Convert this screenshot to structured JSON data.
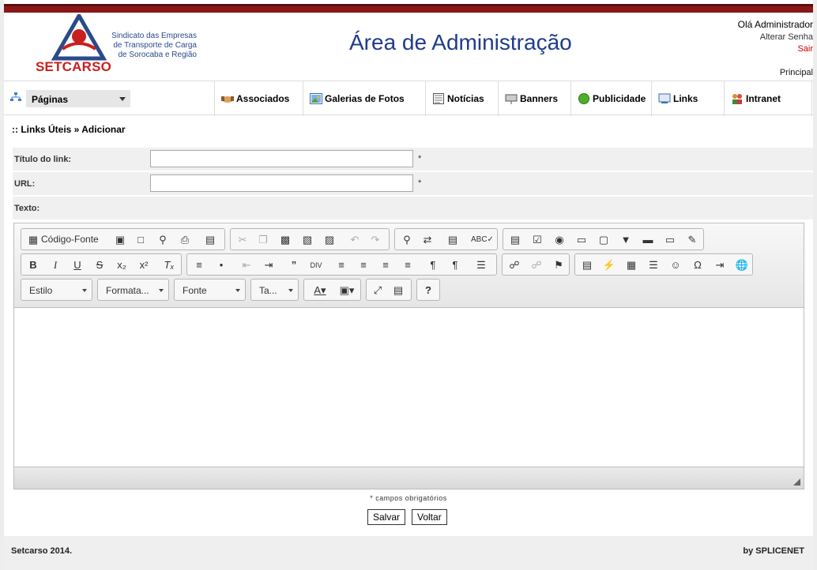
{
  "header": {
    "logo_text": "SETCARSO",
    "logo_caption": [
      "Sindicato das Empresas",
      "de Transporte de Carga",
      "de Sorocaba e Região"
    ],
    "title": "Área de Administração",
    "greeting": "Olá Administrador",
    "change_password": "Alterar Senha",
    "logout": "Sair",
    "home": "Principal"
  },
  "menu": {
    "pages_select": "Páginas",
    "items": [
      {
        "label": "Associados",
        "icon": "handshake-icon"
      },
      {
        "label": "Galerias de Fotos",
        "icon": "photo-gallery-icon"
      },
      {
        "label": "Notícias",
        "icon": "news-icon"
      },
      {
        "label": "Banners",
        "icon": "banner-icon"
      },
      {
        "label": "Publicidade",
        "icon": "green-circle-icon"
      },
      {
        "label": "Links",
        "icon": "links-icon"
      },
      {
        "label": "Intranet",
        "icon": "users-icon"
      }
    ]
  },
  "breadcrumb": ":: Links Úteis » Adicionar",
  "form": {
    "title_label": "Título do link:",
    "title_value": "",
    "url_label": "URL:",
    "url_value": "",
    "text_label": "Texto:",
    "required_mark": "*"
  },
  "editor": {
    "source_label": "Código-Fonte",
    "combos": [
      "Estilo",
      "Formata...",
      "Fonte",
      "Ta..."
    ],
    "help": "?"
  },
  "required_note": "* campos obrigatórios",
  "buttons": {
    "save": "Salvar",
    "back": "Voltar"
  },
  "footer": {
    "left": "Setcarso 2014.",
    "right": "by SPLICENET"
  },
  "colors": {
    "topbar": "#8a1717",
    "title": "#1f3b8c",
    "logo_red": "#c8201e"
  }
}
